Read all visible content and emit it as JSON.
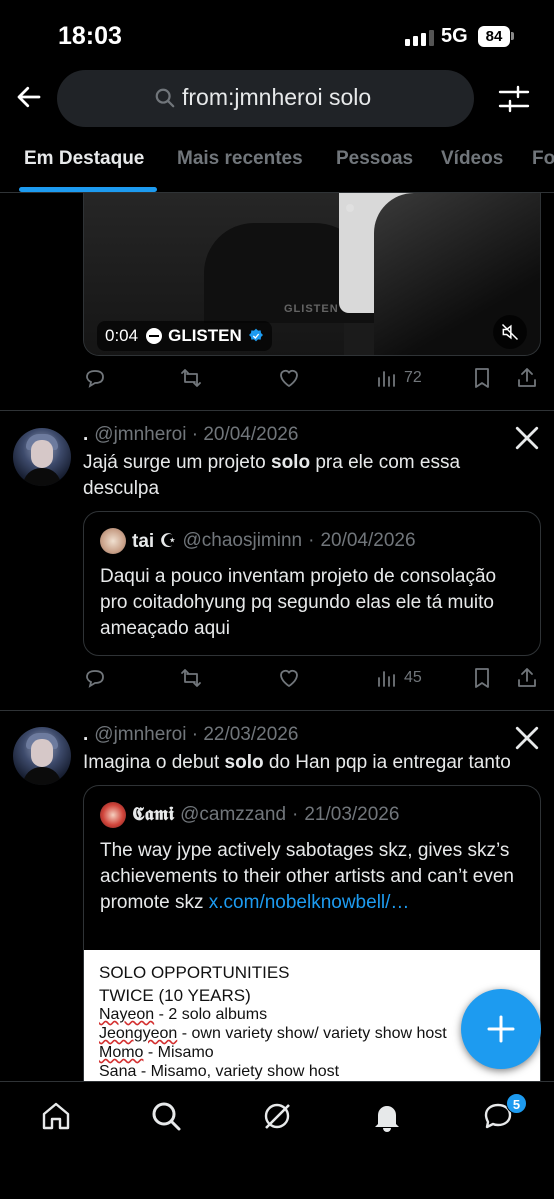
{
  "status": {
    "time": "18:03",
    "network": "5G",
    "battery": "84"
  },
  "search": {
    "query": "from:jmnheroi solo"
  },
  "tabs": [
    {
      "label": "Em Destaque",
      "active": true
    },
    {
      "label": "Mais recentes"
    },
    {
      "label": "Pessoas"
    },
    {
      "label": "Vídeos"
    },
    {
      "label": "Fo"
    }
  ],
  "media": {
    "duration": "0:04",
    "source": "GLISTEN",
    "watermark": "GLISTEN"
  },
  "post0": {
    "views": "72"
  },
  "post1": {
    "handle": "@jmnheroi",
    "date": "20/04/2026",
    "text_before": "Jajá surge um projeto ",
    "text_bold": "solo",
    "text_after": " pra ele com essa desculpa",
    "views": "45",
    "quote": {
      "name": "tai ☪",
      "handle": "@chaosjiminn",
      "date": "20/04/2026",
      "text": "Daqui a pouco inventam projeto de consolação pro coitadohyung pq segundo elas ele tá muito ameaçado aqui"
    }
  },
  "post2": {
    "handle": "@jmnheroi",
    "date": "22/03/2026",
    "text_before": "Imagina o debut ",
    "text_bold": "solo",
    "text_after": " do Han pqp ia entregar tanto",
    "quote": {
      "name": "𝕮𝖆𝖒𝖎",
      "handle": "@camzzand",
      "date": "21/03/2026",
      "text": "The way jype actively sabotages skz, gives skz’s achievements to their other artists and can’t even promote skz ",
      "link": "x.com/nobelknowbell/…",
      "document": {
        "title": "SOLO OPPORTUNITIES",
        "subtitle": "TWICE (10 YEARS)",
        "lines": [
          {
            "name": "Nayeon",
            "detail": " - 2 solo albums"
          },
          {
            "name": "Jeongyeon",
            "detail": " - own variety show/ variety show host"
          },
          {
            "name": "Momo",
            "detail": " - Misamo"
          },
          {
            "name": "Sana",
            "detail": " - Misamo, variety show host"
          }
        ]
      }
    }
  },
  "nav": {
    "messages_badge": "5"
  },
  "colors": {
    "accent": "#1d9bf0",
    "background": "#000000",
    "muted": "#71767b"
  }
}
